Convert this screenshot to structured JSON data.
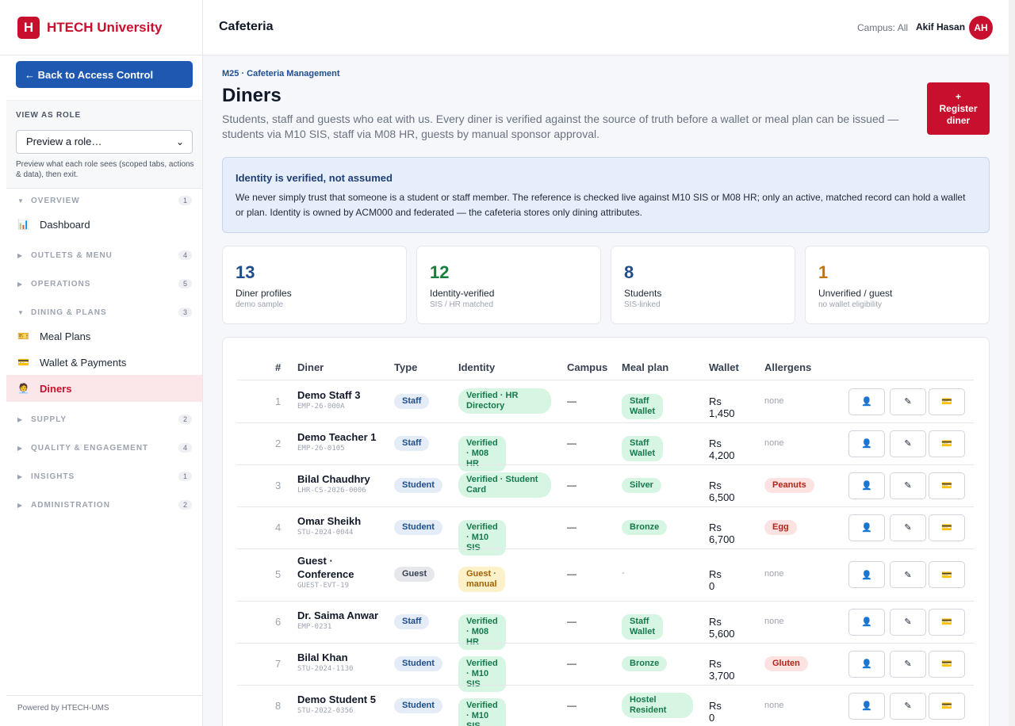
{
  "brand": {
    "logo_letter": "H",
    "name": "HTECH University"
  },
  "sidebar": {
    "back_label": "← Back to Access Control",
    "role_label": "VIEW AS ROLE",
    "role_select_value": "Preview a role…",
    "role_help": "Preview what each role sees (scoped tabs, actions & data), then exit.",
    "sections": [
      {
        "label": "OVERVIEW",
        "count": "1"
      },
      {
        "label": "OUTLETS & MENU",
        "count": "4"
      },
      {
        "label": "OPERATIONS",
        "count": "5"
      },
      {
        "label": "DINING & PLANS",
        "count": "3"
      },
      {
        "label": "SUPPLY",
        "count": "2"
      },
      {
        "label": "QUALITY & ENGAGEMENT",
        "count": "4"
      },
      {
        "label": "INSIGHTS",
        "count": "1"
      },
      {
        "label": "ADMINISTRATION",
        "count": "2"
      }
    ],
    "items": [
      {
        "label": "Dashboard",
        "icon": "📊"
      },
      {
        "label": "Meal Plans",
        "icon": "🎫"
      },
      {
        "label": "Wallet & Payments",
        "icon": "💳"
      },
      {
        "label": "Diners",
        "icon": "🧑‍💼"
      }
    ],
    "footer": "Powered by HTECH-UMS"
  },
  "topbar": {
    "title": "Cafeteria",
    "campus": "Campus: All",
    "user": "Akif Hasan",
    "avatar": "AH"
  },
  "page": {
    "breadcrumb": "M25 · Cafeteria Management",
    "title": "Diners",
    "intro": "Students, staff and guests who eat with us. Every diner is verified against the source of truth before a wallet or meal plan can be issued — students via M10 SIS, staff via M08 HR, guests by manual sponsor approval.",
    "register_plus": "+",
    "register_line1": "Register",
    "register_line2": "diner"
  },
  "notice": {
    "title": "Identity is verified, not assumed",
    "body": "We never simply trust that someone is a student or staff member. The reference is checked live against M10 SIS or M08 HR; only an active, matched record can hold a wallet or plan. Identity is owned by ACM000 and federated — the cafeteria stores only dining attributes."
  },
  "kpis": [
    {
      "value": "13",
      "label": "Diner profiles",
      "sub": "demo sample",
      "color": "#1f4e8c"
    },
    {
      "value": "12",
      "label": "Identity-verified",
      "sub": "SIS / HR matched",
      "color": "#15803d"
    },
    {
      "value": "8",
      "label": "Students",
      "sub": "SIS-linked",
      "color": "#1f4e8c"
    },
    {
      "value": "1",
      "label": "Unverified / guest",
      "sub": "no wallet eligibility",
      "color": "#c2740c"
    }
  ],
  "table": {
    "headers": [
      "#",
      "Diner",
      "Type",
      "Identity",
      "Campus",
      "Meal plan",
      "Wallet",
      "Allergens"
    ],
    "action_icons": [
      "👤",
      "✎",
      "💳"
    ],
    "rows": [
      {
        "n": "1",
        "name": "Demo Staff 3",
        "id": "EMP-26-000A",
        "type": "Staff",
        "identity": "Verified · HR Directory",
        "campus": "—",
        "plan": "Staff Wallet",
        "wallet": "Rs 1,450",
        "allergen": "none"
      },
      {
        "n": "2",
        "name": "Demo Teacher 1",
        "id": "EMP-26-0105",
        "type": "Staff",
        "identity": "Verified · M08 HR",
        "campus": "—",
        "plan": "Staff Wallet",
        "wallet": "Rs 4,200",
        "allergen": "none"
      },
      {
        "n": "3",
        "name": "Bilal Chaudhry",
        "id": "LHR-CS-2026-0006",
        "type": "Student",
        "identity": "Verified · Student Card",
        "campus": "—",
        "plan": "Silver",
        "wallet": "Rs 6,500",
        "allergen": "Peanuts"
      },
      {
        "n": "4",
        "name": "Omar Sheikh",
        "id": "STU-2024-0044",
        "type": "Student",
        "identity": "Verified · M10 SIS",
        "campus": "—",
        "plan": "Bronze",
        "wallet": "Rs 6,700",
        "allergen": "Egg"
      },
      {
        "n": "5",
        "name": "Guest · Conference",
        "id": "GUEST-EVT-19",
        "type": "Guest",
        "identity": "Guest · manual",
        "campus": "—",
        "plan": "-",
        "wallet": "Rs 0",
        "allergen": "none"
      },
      {
        "n": "6",
        "name": "Dr. Saima Anwar",
        "id": "EMP-0231",
        "type": "Staff",
        "identity": "Verified · M08 HR",
        "campus": "—",
        "plan": "Staff Wallet",
        "wallet": "Rs 5,600",
        "allergen": "none"
      },
      {
        "n": "7",
        "name": "Bilal Khan",
        "id": "STU-2024-1130",
        "type": "Student",
        "identity": "Verified · M10 SIS",
        "campus": "—",
        "plan": "Bronze",
        "wallet": "Rs 3,700",
        "allergen": "Gluten"
      },
      {
        "n": "8",
        "name": "Demo Student 5",
        "id": "STU-2022-0356",
        "type": "Student",
        "identity": "Verified · M10 SIS",
        "campus": "—",
        "plan": "Hostel Resident",
        "wallet": "Rs 0",
        "allergen": "none"
      }
    ]
  }
}
